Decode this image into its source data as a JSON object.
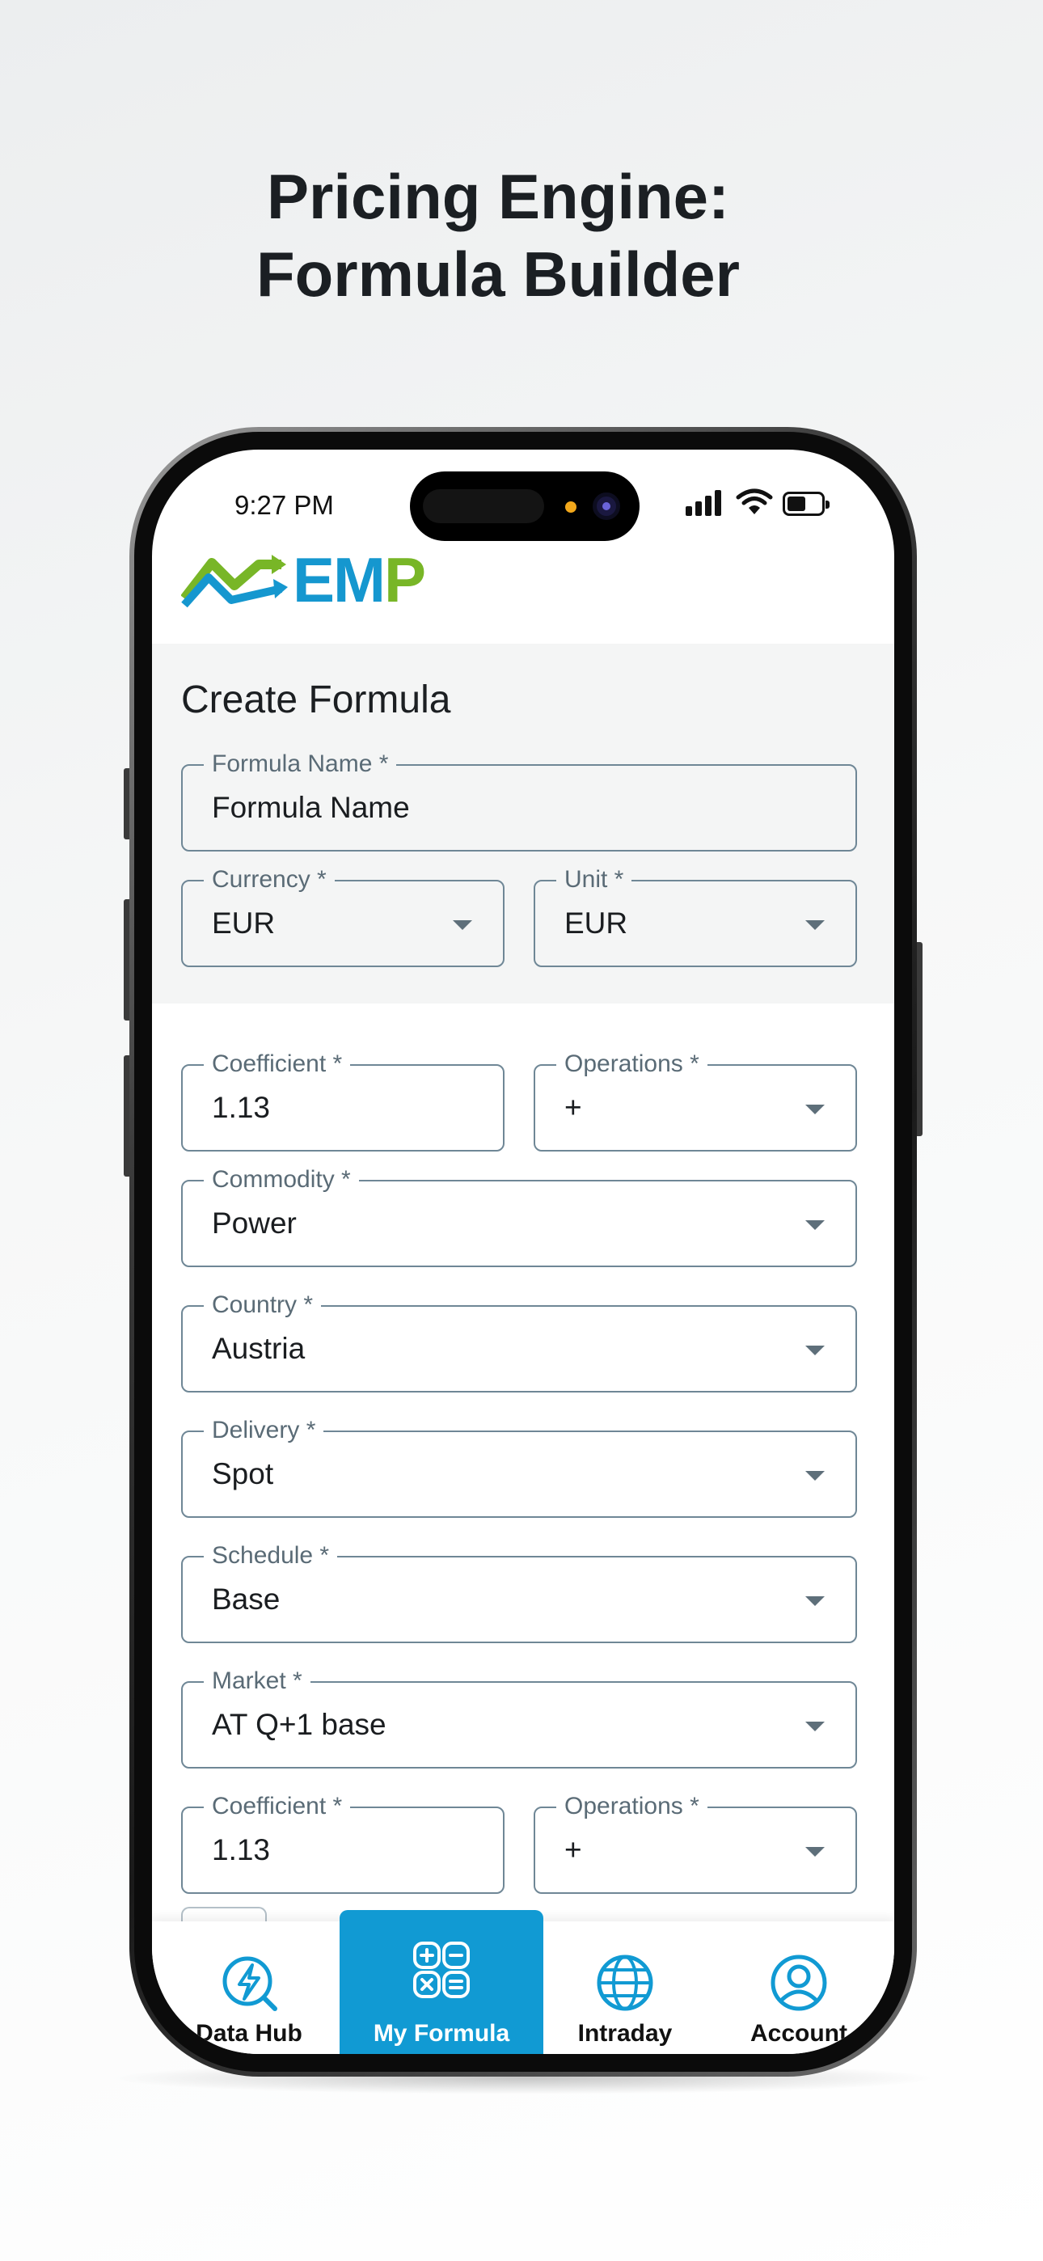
{
  "promo": {
    "title_line1": "Pricing Engine:",
    "title_line2": "Formula Builder"
  },
  "status_bar": {
    "time": "9:27 PM",
    "icons": [
      "signal-icon",
      "wifi-icon",
      "battery-icon"
    ]
  },
  "app": {
    "logo_text_prefix": "EM",
    "logo_text_suffix": "P",
    "brand_colors": {
      "blue": "#1597cf",
      "green": "#78b627"
    }
  },
  "form": {
    "title": "Create Formula",
    "formula_name": {
      "label": "Formula Name *",
      "value": "Formula Name"
    },
    "currency": {
      "label": "Currency *",
      "value": "EUR"
    },
    "unit": {
      "label": "Unit *",
      "value": "EUR"
    }
  },
  "formula_rows": [
    {
      "label": "Coefficient *",
      "value": "1.13"
    },
    {
      "label": "Operations *",
      "value": "+"
    },
    {
      "label": "Commodity *",
      "value": "Power"
    },
    {
      "label": "Country *",
      "value": "Austria"
    },
    {
      "label": "Delivery *",
      "value": "Spot"
    },
    {
      "label": "Schedule *",
      "value": "Base"
    },
    {
      "label": "Market *",
      "value": "AT Q+1 base"
    },
    {
      "label": "Coefficient *",
      "value": "1.13"
    },
    {
      "label": "Operations *",
      "value": "+"
    }
  ],
  "bottom_nav": {
    "active_color": "#119ad3",
    "items": [
      {
        "label": "Data Hub",
        "icon": "lightning-search-icon"
      },
      {
        "label": "My Formula",
        "icon": "calculator-icon"
      },
      {
        "label": "Intraday",
        "icon": "globe-icon"
      },
      {
        "label": "Account",
        "icon": "user-circle-icon"
      }
    ]
  }
}
